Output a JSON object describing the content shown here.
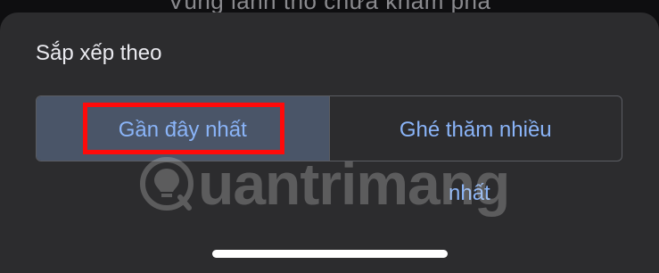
{
  "background": {
    "partial_text": "Vùng lãnh thổ chưa khám phá"
  },
  "sheet": {
    "title": "Sắp xếp theo",
    "options": [
      {
        "label": "Gần đây nhất",
        "selected": true
      },
      {
        "label": "Ghé thăm nhiều",
        "selected": false
      }
    ],
    "overflow_text": "nhất"
  },
  "watermark": {
    "text": "uantrimang"
  },
  "colors": {
    "accent": "#8ab4f8",
    "selected_segment": "#4a5568",
    "sheet_background": "#2c2c2e",
    "annotation_box": "#ff0a0a"
  }
}
